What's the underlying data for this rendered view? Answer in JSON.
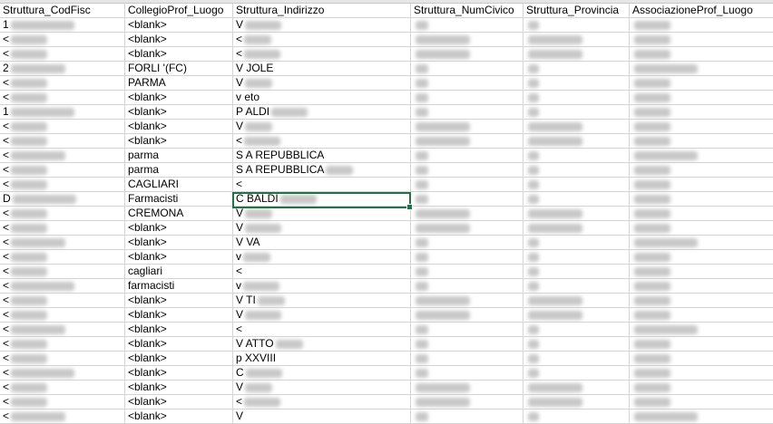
{
  "columns": [
    "Struttura_CodFisc",
    "CollegioProf_Luogo",
    "Struttura_Indirizzo",
    "Struttura_NumCivico",
    "Struttura_Provincia",
    "AssociazioneProf_Luogo"
  ],
  "rows": [
    [
      "1",
      "<blank>",
      "V",
      "",
      "",
      ""
    ],
    [
      "<",
      "<blank>",
      "<",
      "",
      "",
      ""
    ],
    [
      "<",
      "<blank>",
      "<",
      "",
      "",
      ""
    ],
    [
      "2",
      "FORLI '(FC)",
      "V            JOLE",
      "",
      "",
      ""
    ],
    [
      "<",
      "PARMA",
      "V",
      "",
      "",
      ""
    ],
    [
      "<",
      "<blank>",
      "v             eto",
      "",
      "",
      ""
    ],
    [
      "1",
      "<blank>",
      "P          ALDI",
      "",
      "",
      ""
    ],
    [
      "<",
      "<blank>",
      "V",
      "",
      "",
      ""
    ],
    [
      "<",
      "<blank>",
      "<",
      "",
      "",
      ""
    ],
    [
      "<",
      "parma",
      "S              A REPUBBLICA",
      "",
      "",
      ""
    ],
    [
      "<",
      "parma",
      "S              A REPUBBLICA",
      "",
      "",
      ""
    ],
    [
      "<",
      "CAGLIARI",
      "<",
      "",
      "",
      ""
    ],
    [
      "D",
      "Farmacisti",
      "C            BALDI",
      "",
      "",
      ""
    ],
    [
      "<",
      "CREMONA",
      "V",
      "",
      "",
      ""
    ],
    [
      "<",
      "<blank>",
      "V",
      "",
      "",
      ""
    ],
    [
      "<",
      "<blank>",
      "V            VA",
      "",
      "",
      ""
    ],
    [
      "<",
      "<blank>",
      "v",
      "",
      "",
      ""
    ],
    [
      "<",
      "cagliari",
      "<",
      "",
      "",
      ""
    ],
    [
      "<",
      "farmacisti",
      "v",
      "",
      "",
      ""
    ],
    [
      "<",
      "<blank>",
      "V             TI",
      "",
      "",
      ""
    ],
    [
      "<",
      "<blank>",
      "V",
      "",
      "",
      ""
    ],
    [
      "<",
      "<blank>",
      "<",
      "",
      "",
      ""
    ],
    [
      "<",
      "<blank>",
      "V            ATTO",
      "",
      "",
      ""
    ],
    [
      "<",
      "<blank>",
      "p             XXVIII",
      "",
      "",
      ""
    ],
    [
      "<",
      "<blank>",
      "C",
      "",
      "",
      ""
    ],
    [
      "<",
      "<blank>",
      "V",
      "",
      "",
      ""
    ],
    [
      "<",
      "<blank>",
      "<",
      "",
      "",
      ""
    ],
    [
      "<",
      "<blank>",
      "V",
      "",
      "",
      ""
    ]
  ]
}
